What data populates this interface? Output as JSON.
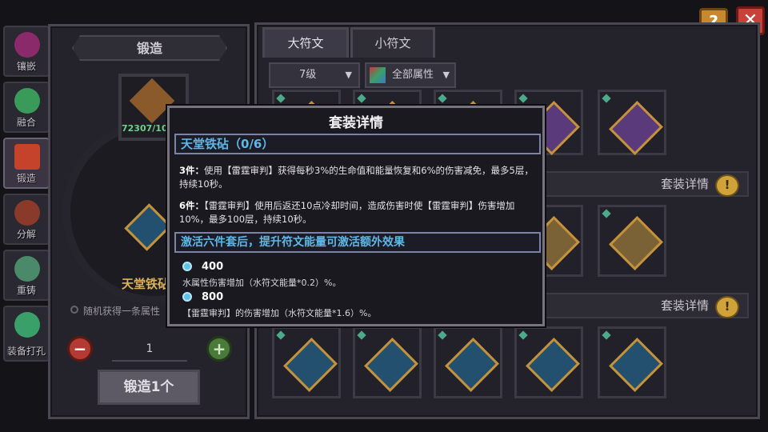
{
  "sidebar": {
    "items": [
      {
        "label": "镶嵌",
        "color": "#8a2a6a"
      },
      {
        "label": "融合",
        "color": "#3a9a5a"
      },
      {
        "label": "锻造",
        "color": "#c4432a"
      },
      {
        "label": "分解",
        "color": "#c4432a"
      },
      {
        "label": "重铸",
        "color": "#4a8a6a"
      },
      {
        "label": "装备打孔",
        "color": "#3aa06a"
      }
    ]
  },
  "forge": {
    "title": "锻造",
    "item_count": "72307/10",
    "item_name": "天堂铁砧",
    "random_text": "随机获得一条属性",
    "quantity": "1",
    "minus": "−",
    "plus": "+",
    "forge_button": "锻造1个"
  },
  "tabs": {
    "major": "大符文",
    "minor": "小符文"
  },
  "filters": {
    "level": "7级",
    "attribute": "全部属性"
  },
  "set_bars": {
    "label": "套装详情",
    "icon": "!"
  },
  "grid": {
    "rows": [
      [
        "gold",
        "gold",
        "gold",
        "purple",
        "purple"
      ],
      [
        "gold",
        "gold",
        "gold",
        "gold",
        "gold"
      ],
      [
        "blue",
        "blue",
        "blue",
        "blue",
        "blue"
      ]
    ]
  },
  "popup": {
    "title": "套装详情",
    "set_name": "天堂铁砧（0/6）",
    "bonus3_prefix": "3件：",
    "bonus3_text": "使用【雷霆审判】获得每秒3%的生命值和能量恢复和6%的伤害减免，最多5层，持续10秒。",
    "bonus6_prefix": "6件：",
    "bonus6_text": "【雷霆审判】使用后返还10点冷却时间，造成伤害时使【雷霆审判】伤害增加10%，最多100层，持续10秒。",
    "extra_head": "激活六件套后，提升符文能量可激活额外效果",
    "tiers": [
      {
        "value": "400",
        "desc": "水属性伤害增加（水符文能量*0.2）%。"
      },
      {
        "value": "800",
        "desc": "【雷霆审判】的伤害增加（水符文能量*1.6）%。"
      }
    ]
  },
  "top_buttons": {
    "help": "?",
    "close": "✕"
  }
}
